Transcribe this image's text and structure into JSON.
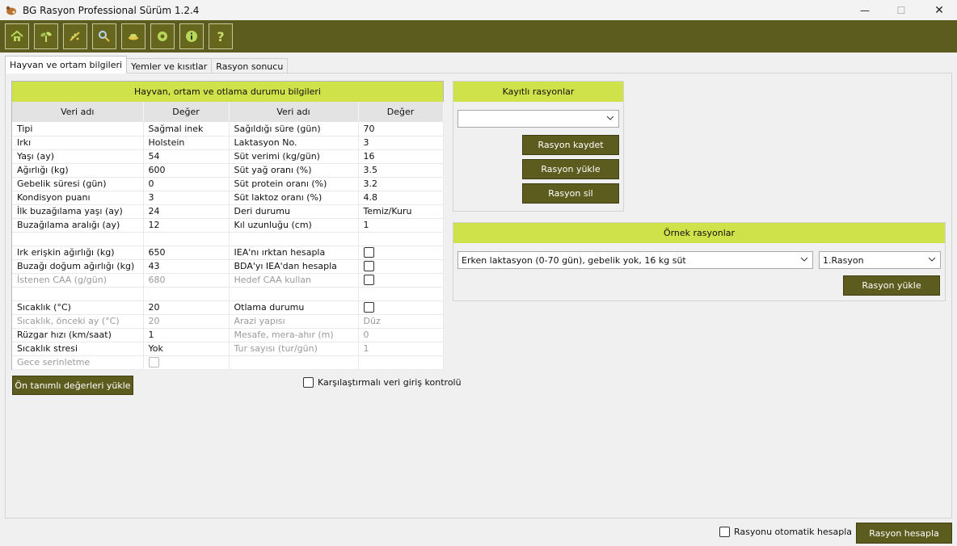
{
  "window": {
    "title": "BG Rasyon Professional Sürüm 1.2.4",
    "minimize": "—",
    "maximize": "☐",
    "close": "✕"
  },
  "toolbar": {
    "icons": [
      "home-icon",
      "plant-icon",
      "feed-icon",
      "analysis-icon",
      "mix-icon",
      "settings-icon",
      "info-icon",
      "help-icon"
    ],
    "help_label": "?"
  },
  "tabs": [
    {
      "label": "Hayvan ve ortam bilgileri",
      "active": true
    },
    {
      "label": "Yemler ve kısıtlar",
      "active": false
    },
    {
      "label": "Rasyon sonucu",
      "active": false
    }
  ],
  "grid": {
    "title": "Hayvan, ortam ve otlama durumu bilgileri",
    "headers": [
      "Veri adı",
      "Değer",
      "Veri adı",
      "Değer"
    ],
    "rows": [
      [
        "Tipi",
        "Sağmal inek",
        "Sağıldığı süre (gün)",
        "70"
      ],
      [
        "Irkı",
        "Holstein",
        "Laktasyon No.",
        "3"
      ],
      [
        "Yaşı (ay)",
        "54",
        "Süt verimi (kg/gün)",
        "16"
      ],
      [
        "Ağırlığı (kg)",
        "600",
        "Süt yağ oranı (%)",
        "3.5"
      ],
      [
        "Gebelik süresi (gün)",
        "0",
        "Süt protein oranı (%)",
        "3.2"
      ],
      [
        "Kondisyon puanı",
        "3",
        "Süt laktoz oranı (%)",
        "4.8"
      ],
      [
        "İlk buzağılama yaşı (ay)",
        "24",
        "Deri durumu",
        "Temiz/Kuru"
      ],
      [
        "Buzağılama aralığı (ay)",
        "12",
        "Kıl uzunluğu (cm)",
        "1"
      ],
      [
        "",
        "",
        "",
        ""
      ],
      [
        "Irk erişkin ağırlığı (kg)",
        "650",
        "IEA'nı ırktan hesapla",
        "[ ]"
      ],
      [
        "Buzağı doğum ağırlığı (kg)",
        "43",
        "BDA'yı IEA'dan hesapla",
        "[ ]"
      ],
      [
        "İstenen CAA (g/gün)",
        "680",
        "Hedef CAA kullan",
        "[x]"
      ],
      [
        "",
        "",
        "",
        ""
      ],
      [
        "Sıcaklık (°C)",
        "20",
        "Otlama durumu",
        "[ ]"
      ],
      [
        "Sıcaklık, önceki ay (°C)",
        "20",
        "Arazi yapısı",
        "Düz"
      ],
      [
        "Rüzgar hızı (km/saat)",
        "1",
        "Mesafe, mera-ahır (m)",
        "0"
      ],
      [
        "Sıcaklık stresi",
        "Yok",
        "Tur sayısı (tur/gün)",
        "1"
      ],
      [
        "Gece serinletme",
        "[ ]",
        "",
        ""
      ]
    ]
  },
  "left_actions": {
    "load_defaults": "Ön tanımlı değerleri yükle",
    "compare_check": "Karşılaştırmalı veri giriş kontrolü"
  },
  "saved_rations": {
    "title": "Kayıtlı rasyonlar",
    "selected": "",
    "save": "Rasyon kaydet",
    "load": "Rasyon yükle",
    "delete": "Rasyon sil"
  },
  "sample_rations": {
    "title": "Örnek rasyonlar",
    "scenario": "Erken laktasyon (0-70 gün), gebelik yok, 16 kg süt",
    "ration": "1.Rasyon",
    "load": "Rasyon yükle"
  },
  "status": {
    "auto_calc": "Rasyonu otomatik hesapla",
    "calculate": "Rasyon hesapla"
  }
}
